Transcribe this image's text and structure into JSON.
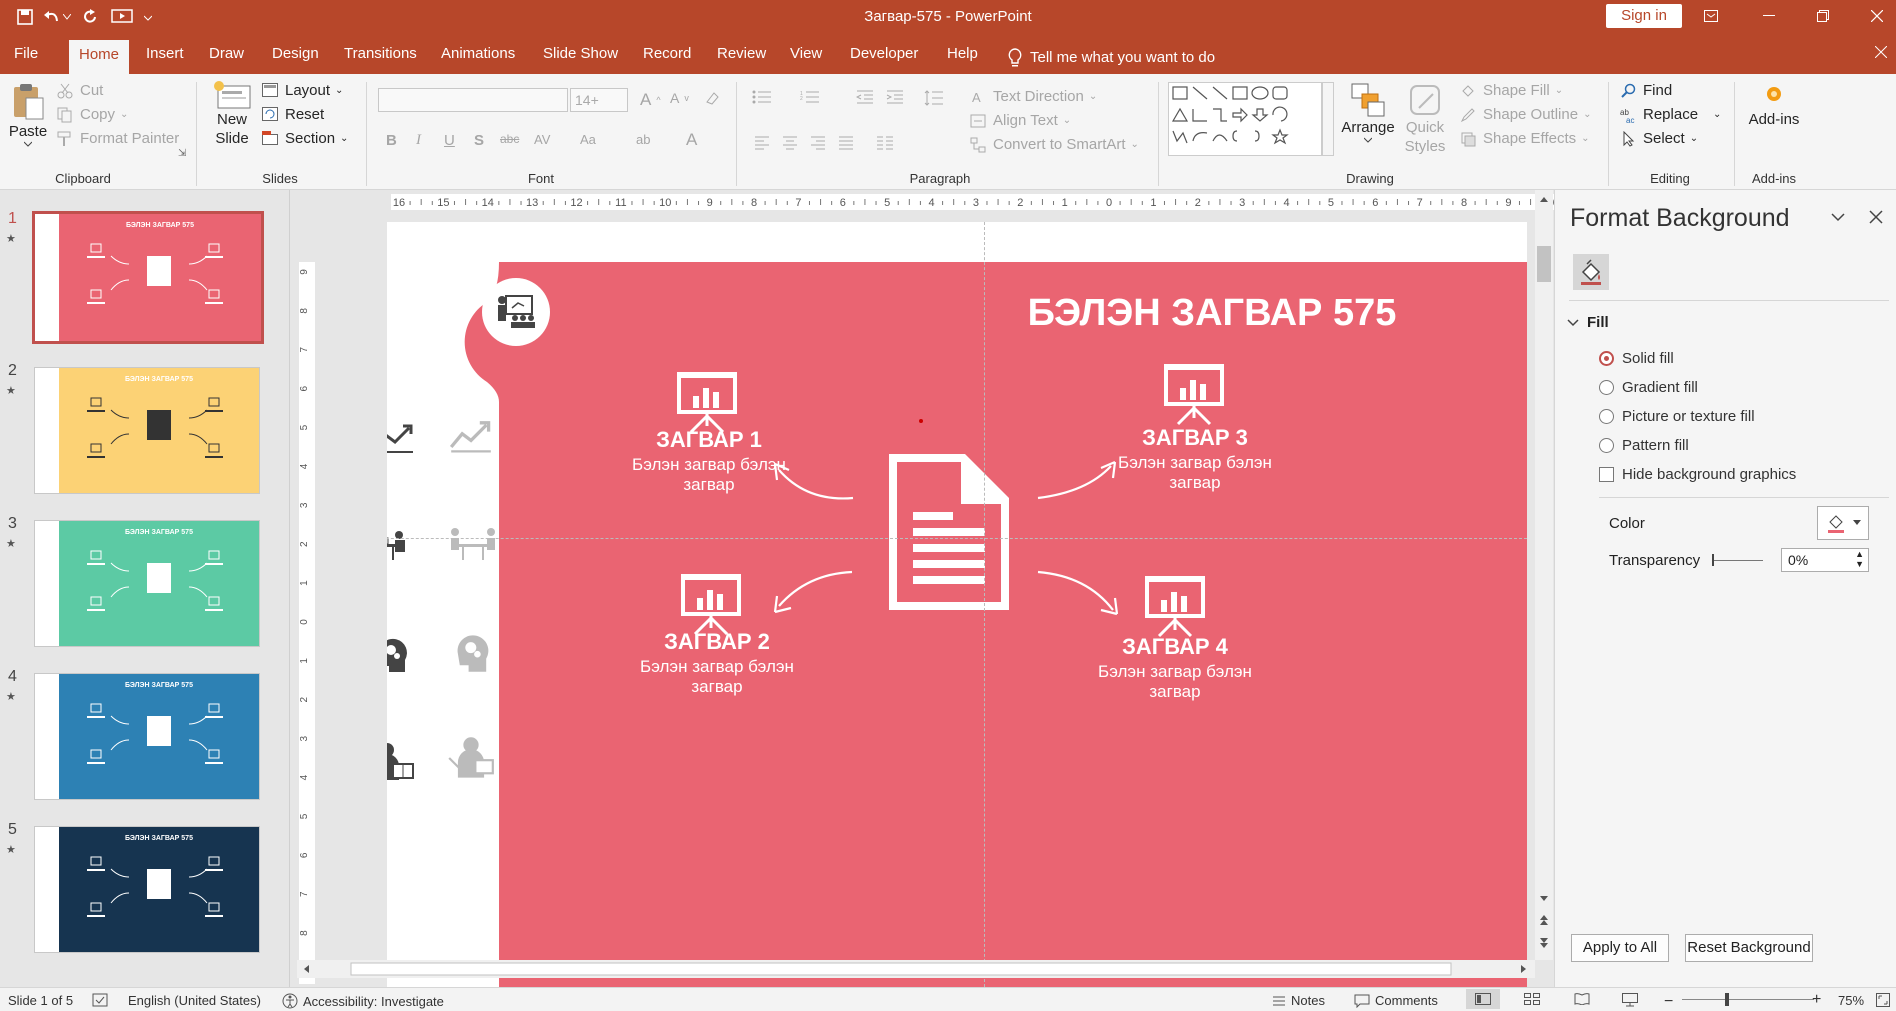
{
  "window": {
    "title": "Загвар-575  -  PowerPoint",
    "sign_in": "Sign in"
  },
  "tabs": [
    "File",
    "Home",
    "Insert",
    "Draw",
    "Design",
    "Transitions",
    "Animations",
    "Slide Show",
    "Record",
    "Review",
    "View",
    "Developer",
    "Help"
  ],
  "tell_me": "Tell me what you want to do",
  "ribbon": {
    "clipboard": {
      "paste": "Paste",
      "cut": "Cut",
      "copy": "Copy",
      "format_painter": "Format Painter",
      "label": "Clipboard"
    },
    "slides": {
      "new_slide_1": "New",
      "new_slide_2": "Slide",
      "layout": "Layout",
      "reset": "Reset",
      "section": "Section",
      "label": "Slides"
    },
    "font": {
      "size": "14+",
      "label": "Font"
    },
    "paragraph": {
      "text_direction": "Text Direction",
      "align_text": "Align Text",
      "convert_smartart": "Convert to SmartArt",
      "label": "Paragraph"
    },
    "drawing": {
      "arrange": "Arrange",
      "quick_styles_1": "Quick",
      "quick_styles_2": "Styles",
      "shape_fill": "Shape Fill",
      "shape_outline": "Shape Outline",
      "shape_effects": "Shape Effects",
      "label": "Drawing"
    },
    "editing": {
      "find": "Find",
      "replace": "Replace",
      "select": "Select",
      "label": "Editing"
    },
    "addins": {
      "button": "Add-ins",
      "label": "Add-ins"
    }
  },
  "thumbnails": [
    {
      "num": "1",
      "title": "БЭЛЭН ЗАГВАР 575",
      "color": "#ea6472"
    },
    {
      "num": "2",
      "title": "БЭЛЭН ЗАГВАР 575",
      "color": "#fcd275"
    },
    {
      "num": "3",
      "title": "БЭЛЭН ЗАГВАР 575",
      "color": "#5ccaa4"
    },
    {
      "num": "4",
      "title": "БЭЛЭН ЗАГВАР 575",
      "color": "#2d81b4"
    },
    {
      "num": "5",
      "title": "БЭЛЭН ЗАГВАР 575",
      "color": "#163450"
    }
  ],
  "ruler": {
    "h": [
      "16",
      "15",
      "14",
      "13",
      "12",
      "11",
      "10",
      "9",
      "8",
      "7",
      "6",
      "5",
      "4",
      "3",
      "2",
      "1",
      "0",
      "1",
      "2",
      "3",
      "4",
      "5",
      "6",
      "7",
      "8",
      "9",
      "10",
      "11",
      "12",
      "13",
      "14",
      "15",
      "16"
    ],
    "v": [
      "9",
      "8",
      "7",
      "6",
      "5",
      "4",
      "3",
      "2",
      "1",
      "0",
      "1",
      "2",
      "3",
      "4",
      "5",
      "6",
      "7",
      "8",
      "9"
    ]
  },
  "slide": {
    "title": "БЭЛЭН ЗАГВАР 575",
    "bg_color": "#ea6472",
    "items": [
      {
        "heading": "ЗАГВАР 1",
        "desc": "Бэлэн загвар бэлэн загвар"
      },
      {
        "heading": "ЗАГВАР 2",
        "desc": "Бэлэн загвар бэлэн загвар"
      },
      {
        "heading": "ЗАГВАР 3",
        "desc": "Бэлэн загвар бэлэн загвар"
      },
      {
        "heading": "ЗАГВАР 4",
        "desc": "Бэлэн загвар бэлэн загвар"
      }
    ]
  },
  "format_pane": {
    "title": "Format Background",
    "fill_section": "Fill",
    "options": [
      "Solid fill",
      "Gradient fill",
      "Picture or texture fill",
      "Pattern fill"
    ],
    "selected_option": "Solid fill",
    "hide_bg_graphics": "Hide background graphics",
    "color_label": "Color",
    "transparency_label": "Transparency",
    "transparency_value": "0%",
    "apply_all": "Apply to All",
    "reset_bg": "Reset Background"
  },
  "status": {
    "slide_info": "Slide 1 of 5",
    "language": "English (United States)",
    "accessibility": "Accessibility: Investigate",
    "notes": "Notes",
    "comments": "Comments",
    "zoom": "75%"
  },
  "colors": {
    "accent": "#b7472a",
    "slide_bg": "#ea6472"
  }
}
